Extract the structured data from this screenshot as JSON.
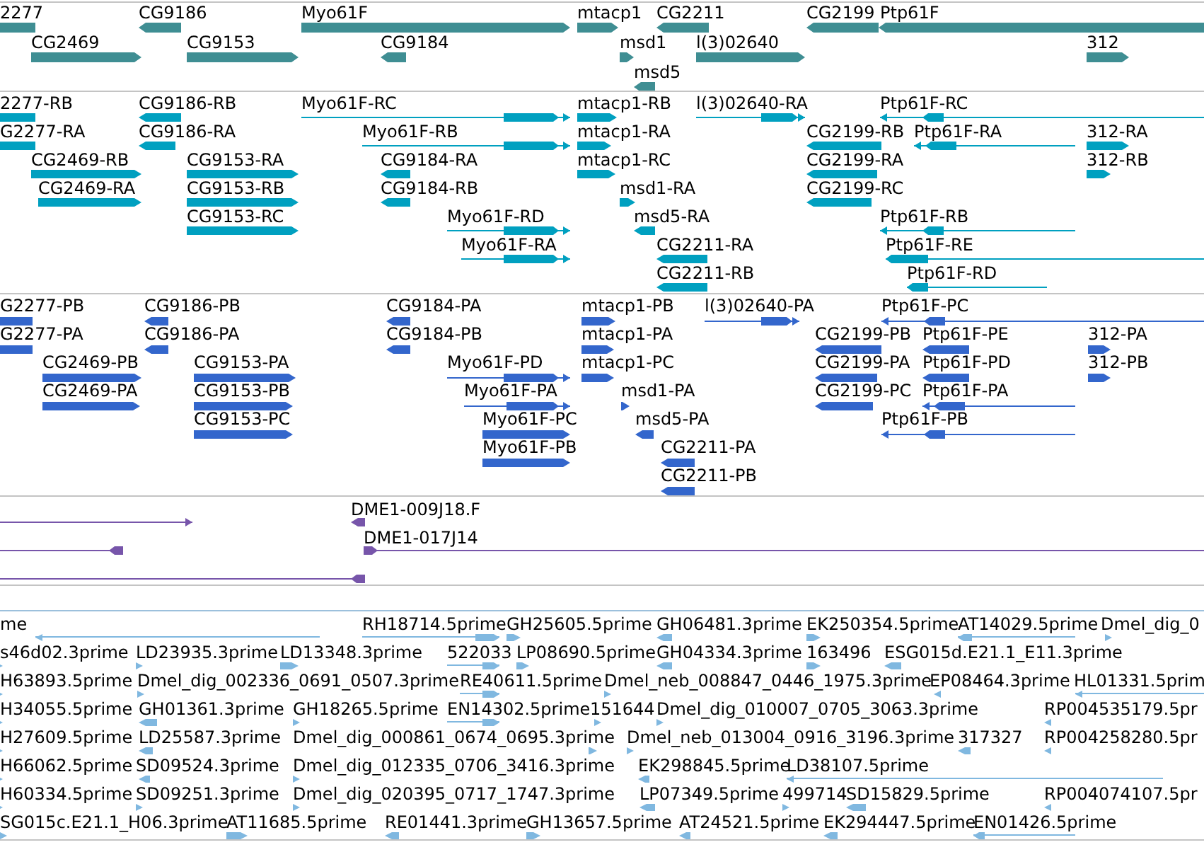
{
  "tracks": [
    {
      "color": "#3f8e93",
      "features": [
        {
          "label": "2277",
          "reverse": true
        },
        {
          "label": "CG9186",
          "reverse": true
        },
        {
          "label": "Myo61F",
          "reverse": false
        },
        {
          "label": "mtacp1",
          "reverse": false
        },
        {
          "label": "CG2211",
          "reverse": true
        },
        {
          "label": "CG2199",
          "reverse": true
        },
        {
          "label": "Ptp61F",
          "reverse": true
        },
        {
          "label": "CG2469",
          "reverse": false
        },
        {
          "label": "CG9153",
          "reverse": false
        },
        {
          "label": "CG9184",
          "reverse": true
        },
        {
          "label": "msd1",
          "reverse": false
        },
        {
          "label": "l(3)02640",
          "reverse": false
        },
        {
          "label": "312",
          "reverse": false
        },
        {
          "label": "msd5",
          "reverse": true
        }
      ]
    },
    {
      "color": "#00a0c0",
      "features": [
        {
          "label": "2277-RB",
          "reverse": true
        },
        {
          "label": "CG9186-RB",
          "reverse": true
        },
        {
          "label": "Myo61F-RC",
          "reverse": false
        },
        {
          "label": "mtacp1-RB",
          "reverse": false
        },
        {
          "label": "l(3)02640-RA",
          "reverse": false
        },
        {
          "label": "Ptp61F-RC",
          "reverse": true
        },
        {
          "label": "G2277-RA",
          "reverse": true
        },
        {
          "label": "CG9186-RA",
          "reverse": true
        },
        {
          "label": "Myo61F-RB",
          "reverse": false
        },
        {
          "label": "mtacp1-RA",
          "reverse": false
        },
        {
          "label": "CG2199-RB",
          "reverse": true
        },
        {
          "label": "Ptp61F-RA",
          "reverse": true
        },
        {
          "label": "312-RA",
          "reverse": false
        },
        {
          "label": "CG2469-RB",
          "reverse": false
        },
        {
          "label": "CG9153-RA",
          "reverse": false
        },
        {
          "label": "CG9184-RA",
          "reverse": true
        },
        {
          "label": "mtacp1-RC",
          "reverse": false
        },
        {
          "label": "CG2199-RA",
          "reverse": true
        },
        {
          "label": "312-RB",
          "reverse": false
        },
        {
          "label": "CG2469-RA",
          "reverse": false
        },
        {
          "label": "CG9153-RB",
          "reverse": false
        },
        {
          "label": "CG9184-RB",
          "reverse": true
        },
        {
          "label": "msd1-RA",
          "reverse": false
        },
        {
          "label": "CG2199-RC",
          "reverse": true
        },
        {
          "label": "CG9153-RC",
          "reverse": false
        },
        {
          "label": "Myo61F-RD",
          "reverse": false
        },
        {
          "label": "msd5-RA",
          "reverse": true
        },
        {
          "label": "Ptp61F-RB",
          "reverse": true
        },
        {
          "label": "Myo61F-RA",
          "reverse": false
        },
        {
          "label": "CG2211-RA",
          "reverse": true
        },
        {
          "label": "Ptp61F-RE",
          "reverse": true
        },
        {
          "label": "CG2211-RB",
          "reverse": true
        },
        {
          "label": "Ptp61F-RD",
          "reverse": true
        }
      ]
    },
    {
      "color": "#3366cc",
      "features": [
        {
          "label": "G2277-PB",
          "reverse": true
        },
        {
          "label": "CG9186-PB",
          "reverse": true
        },
        {
          "label": "CG9184-PA",
          "reverse": true
        },
        {
          "label": "mtacp1-PB",
          "reverse": false
        },
        {
          "label": "l(3)02640-PA",
          "reverse": false
        },
        {
          "label": "Ptp61F-PC",
          "reverse": true
        },
        {
          "label": "G2277-PA",
          "reverse": true
        },
        {
          "label": "CG9186-PA",
          "reverse": true
        },
        {
          "label": "CG9184-PB",
          "reverse": true
        },
        {
          "label": "mtacp1-PA",
          "reverse": false
        },
        {
          "label": "CG2199-PB",
          "reverse": true
        },
        {
          "label": "Ptp61F-PE",
          "reverse": true
        },
        {
          "label": "312-PA",
          "reverse": false
        },
        {
          "label": "CG2469-PB",
          "reverse": false
        },
        {
          "label": "CG9153-PA",
          "reverse": false
        },
        {
          "label": "Myo61F-PD",
          "reverse": false
        },
        {
          "label": "mtacp1-PC",
          "reverse": false
        },
        {
          "label": "CG2199-PA",
          "reverse": true
        },
        {
          "label": "Ptp61F-PD",
          "reverse": true
        },
        {
          "label": "312-PB",
          "reverse": false
        },
        {
          "label": "CG2469-PA",
          "reverse": false
        },
        {
          "label": "CG9153-PB",
          "reverse": false
        },
        {
          "label": "Myo61F-PA",
          "reverse": false
        },
        {
          "label": "msd1-PA",
          "reverse": false
        },
        {
          "label": "CG2199-PC",
          "reverse": true
        },
        {
          "label": "Ptp61F-PA",
          "reverse": true
        },
        {
          "label": "CG9153-PC",
          "reverse": false
        },
        {
          "label": "Myo61F-PC",
          "reverse": false
        },
        {
          "label": "msd5-PA",
          "reverse": true
        },
        {
          "label": "Ptp61F-PB",
          "reverse": true
        },
        {
          "label": "Myo61F-PB",
          "reverse": false
        },
        {
          "label": "CG2211-PA",
          "reverse": true
        },
        {
          "label": "CG2211-PB",
          "reverse": true
        }
      ]
    },
    {
      "color": "#7755aa",
      "features": [
        {
          "reverse": false
        },
        {
          "label": "DME1-009J18.F",
          "reverse": true
        },
        {
          "reverse": true
        },
        {
          "label": "DME1-017J14",
          "reverse": false
        },
        {
          "reverse": true
        }
      ]
    },
    {
      "color": "#80b8e0",
      "features": [
        {
          "label": "me",
          "reverse": true
        },
        {
          "label": "RH18714.5prime",
          "reverse": false
        },
        {
          "label": "GH25605.5prime",
          "reverse": false
        },
        {
          "label": "GH06481.3prime",
          "reverse": true
        },
        {
          "label": "EK250354.5prime",
          "reverse": false
        },
        {
          "label": "AT14029.5prime",
          "reverse": true
        },
        {
          "label": "Dmel_dig_0",
          "reverse": false
        },
        {
          "label": "s46d02.3prime",
          "reverse": false
        },
        {
          "label": "LD23935.3prime",
          "reverse": false
        },
        {
          "label": "LD13348.3prime",
          "reverse": false
        },
        {
          "label": "522033",
          "reverse": false
        },
        {
          "label": "LP08690.5prime",
          "reverse": false
        },
        {
          "label": "GH04334.3prime",
          "reverse": true
        },
        {
          "label": "163496",
          "reverse": false
        },
        {
          "label": "ESG015d.E21.1_E11.3prime",
          "reverse": true
        },
        {
          "label": "H63893.5prime",
          "reverse": false
        },
        {
          "label": "Dmel_dig_002336_0691_0507.3prime",
          "reverse": false
        },
        {
          "label": "RE40611.5prime",
          "reverse": false
        },
        {
          "label": "Dmel_neb_008847_0446_1975.3prime",
          "reverse": false
        },
        {
          "label": "EP08464.3prime",
          "reverse": true
        },
        {
          "label": "HL01331.5prim",
          "reverse": true
        },
        {
          "label": "H34055.5prime",
          "reverse": false
        },
        {
          "label": "GH01361.3prime",
          "reverse": true
        },
        {
          "label": "GH18265.5prime",
          "reverse": false
        },
        {
          "label": "EN14302.5prime",
          "reverse": false
        },
        {
          "label": "151644",
          "reverse": false
        },
        {
          "label": "Dmel_dig_010007_0705_3063.3prime",
          "reverse": false
        },
        {
          "label": "RP004535179.5pr",
          "reverse": true
        },
        {
          "label": "H27609.5prime",
          "reverse": false
        },
        {
          "label": "LD25587.3prime",
          "reverse": true
        },
        {
          "label": "Dmel_dig_000861_0674_0695.3prime",
          "reverse": false
        },
        {
          "label": "Dmel_neb_013004_0916_3196.3prime",
          "reverse": false
        },
        {
          "label": "317327",
          "reverse": true
        },
        {
          "label": "RP004258280.5pr",
          "reverse": true
        },
        {
          "label": "H66062.5prime",
          "reverse": false
        },
        {
          "label": "SD09524.3prime",
          "reverse": true
        },
        {
          "label": "Dmel_dig_012335_0706_3416.3prime",
          "reverse": false
        },
        {
          "label": "EK298845.5prime",
          "reverse": true
        },
        {
          "label": "LD38107.5prime",
          "reverse": true
        },
        {
          "label": "H60334.5prime",
          "reverse": false
        },
        {
          "label": "SD09251.3prime",
          "reverse": false
        },
        {
          "label": "Dmel_dig_020395_0717_1747.3prime",
          "reverse": false
        },
        {
          "label": "LP07349.5prime",
          "reverse": true
        },
        {
          "label": "499714",
          "reverse": false
        },
        {
          "label": "SD15829.5prime",
          "reverse": true
        },
        {
          "label": "RP004074107.5pr",
          "reverse": true
        },
        {
          "label": "SG015c.E21.1_H06.3prime",
          "reverse": false
        },
        {
          "label": "AT11685.5prime",
          "reverse": false
        },
        {
          "label": "RE01441.3prime",
          "reverse": true
        },
        {
          "label": "GH13657.5prime",
          "reverse": false
        },
        {
          "label": "AT24521.5prime",
          "reverse": true
        },
        {
          "label": "EK294447.5prime",
          "reverse": true
        },
        {
          "label": "EN01426.5prime",
          "reverse": true
        }
      ]
    }
  ]
}
